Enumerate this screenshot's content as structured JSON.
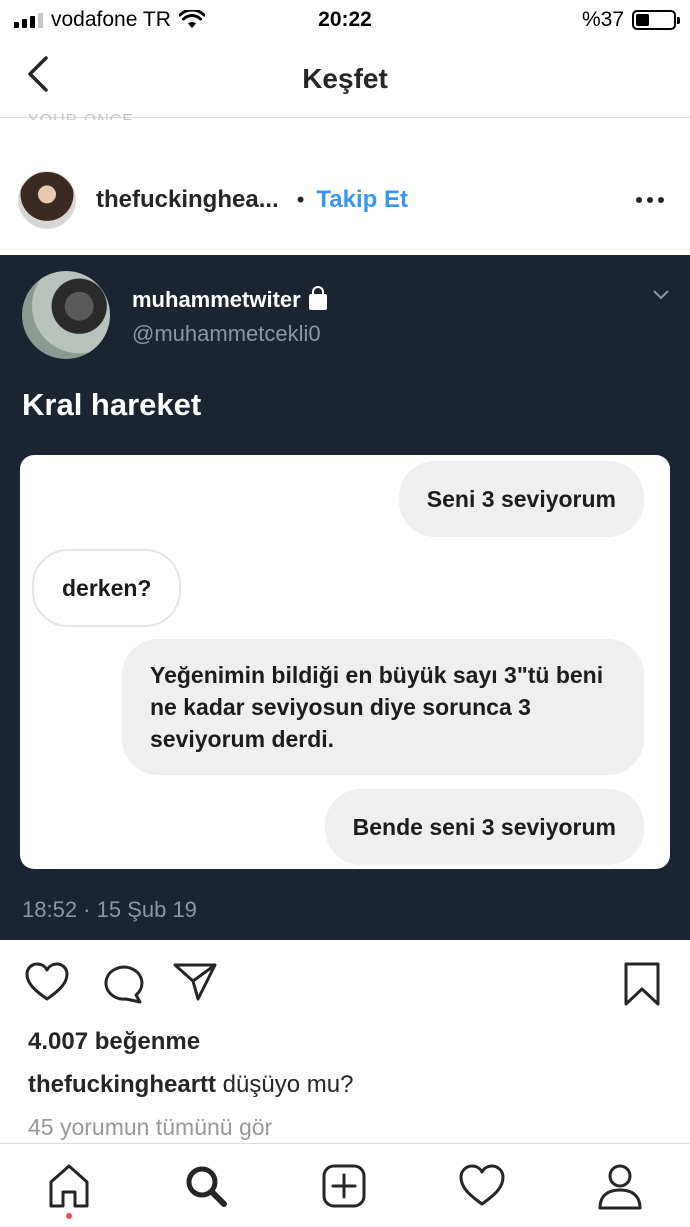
{
  "status_bar": {
    "carrier": "vodafone TR",
    "time": "20:22",
    "battery": "%37",
    "battery_level": 0.37
  },
  "nav": {
    "title": "Keşfet"
  },
  "cut_text": "YOUR ONCE",
  "post": {
    "username": "thefuckinghea...",
    "follow_label": "Takip Et",
    "tweet": {
      "name": "muhammetwiter",
      "handle": "@muhammetcekli0",
      "text": "Kral hareket",
      "messages": [
        "Seni 3 seviyorum",
        "derken?",
        "Yeğenimin bildiği en büyük sayı 3\"tü beni ne kadar seviyosun diye sorunca 3 seviyorum derdi.",
        "Bende seni 3 seviyorum"
      ],
      "timestamp": "18:52 · 15 Şub 19"
    },
    "likes": "4.007 beğenme",
    "caption_user": "thefuckingheartt",
    "caption_text": " düşüyo mu?",
    "comments_link": "45 yorumun tümünü gör"
  }
}
